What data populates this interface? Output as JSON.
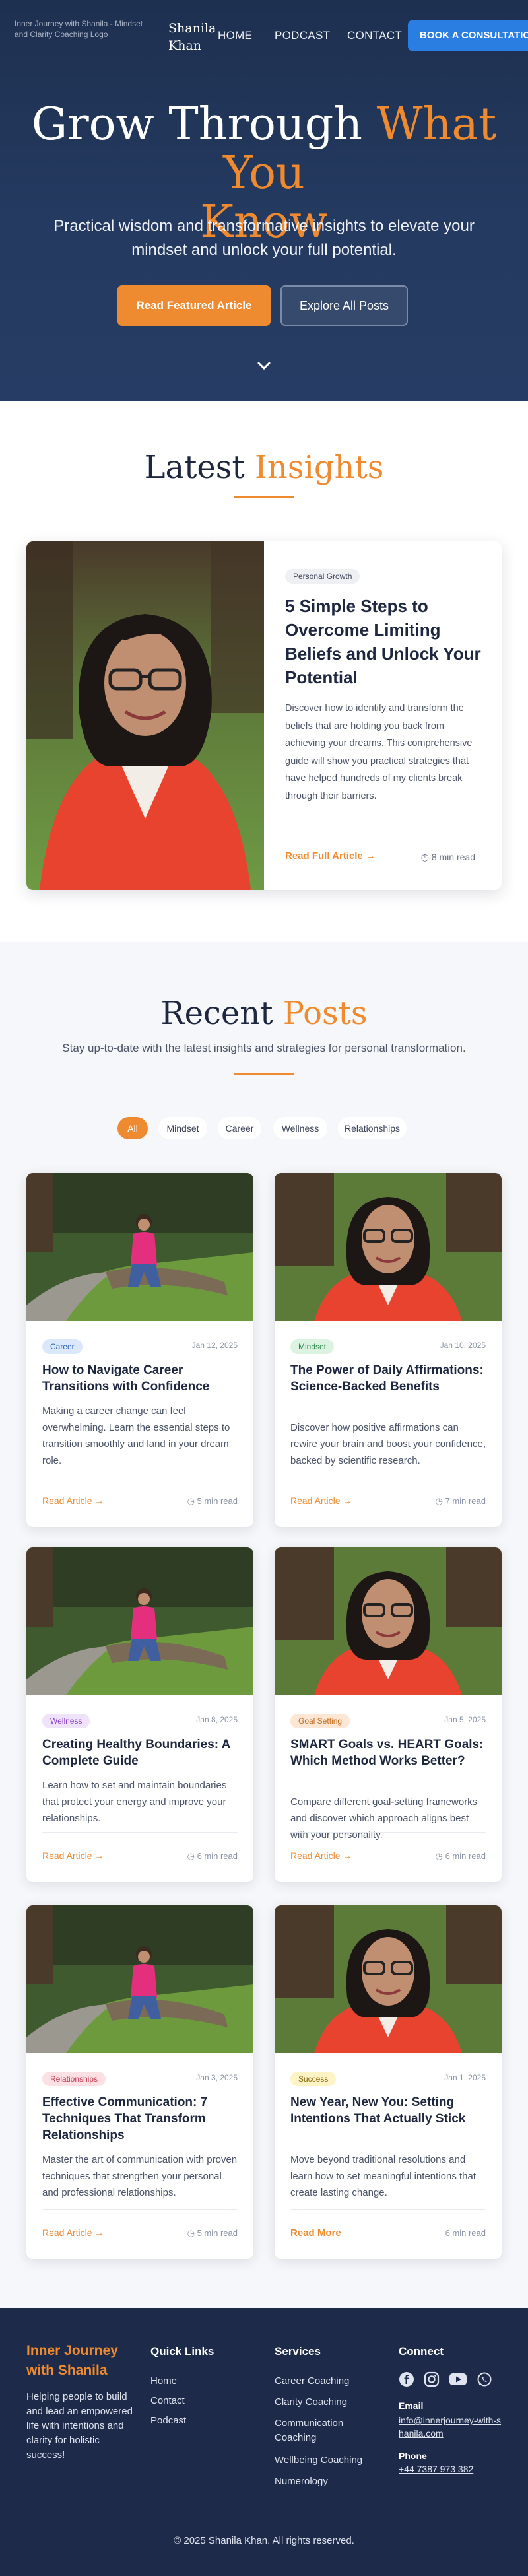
{
  "nav": {
    "logo_alt": "Inner Journey with Shanila - Mindset and Clarity Coaching Logo",
    "brand": [
      "Shanila",
      "Khan"
    ],
    "links": [
      "HOME",
      "PODCAST",
      "CONTACT"
    ],
    "cta": "BOOK A CONSULTATION"
  },
  "hero": {
    "title_plain": "Grow Through ",
    "title_accent_1": "What You",
    "title_accent_2": "Know",
    "subtitle": "Practical wisdom and transformative insights to elevate your mindset and unlock your full potential.",
    "primary_button": "Read Featured Article",
    "secondary_button": "Explore All Posts"
  },
  "latest": {
    "title_plain": "Latest ",
    "title_accent": "Insights",
    "featured": {
      "tag": "Personal Growth",
      "title": "5 Simple Steps to Overcome Limiting Beliefs and Unlock Your Potential",
      "excerpt": "Discover how to identify and transform the beliefs that are holding you back from achieving your dreams. This comprehensive guide will show you practical strategies that have helped hundreds of my clients break through their barriers.",
      "read_link": "Read Full Article",
      "read_time": "8 min read"
    }
  },
  "recent": {
    "title_plain": "Recent ",
    "title_accent": "Posts",
    "subtitle": "Stay up-to-date with the latest insights and strategies for personal transformation.",
    "filters": [
      "All",
      "Mindset",
      "Career",
      "Wellness",
      "Relationships"
    ],
    "active_filter": "All",
    "posts": [
      {
        "tag": "Career",
        "tag_bg": "#dbe8fb",
        "tag_fg": "#2a5fb5",
        "date": "Jan 12, 2025",
        "title": "How to Navigate Career Transitions with Confidence",
        "excerpt": "Making a career change can feel overwhelming. Learn the essential steps to transition smoothly and land in your dream role.",
        "read": "Read Article",
        "time": "5 min read",
        "photo": "park"
      },
      {
        "tag": "Mindset",
        "tag_bg": "#dcf3e2",
        "tag_fg": "#2a8a4a",
        "date": "Jan 10, 2025",
        "title": "The Power of Daily Affirmations: Science-Backed Benefits",
        "excerpt": "Discover how positive affirmations can rewire your brain and boost your confidence, backed by scientific research.",
        "read": "Read Article",
        "time": "7 min read",
        "photo": "portrait"
      },
      {
        "tag": "Wellness",
        "tag_bg": "#efe2fb",
        "tag_fg": "#8a45c9",
        "date": "Jan 8, 2025",
        "title": "Creating Healthy Boundaries: A Complete Guide",
        "excerpt": "Learn how to set and maintain boundaries that protect your energy and improve your relationships.",
        "read": "Read Article",
        "time": "6 min read",
        "photo": "park"
      },
      {
        "tag": "Goal Setting",
        "tag_bg": "#fde6d3",
        "tag_fg": "#c46a1d",
        "date": "Jan 5, 2025",
        "title": "SMART Goals vs. HEART Goals: Which Method Works Better?",
        "excerpt": "Compare different goal-setting frameworks and discover which approach aligns best with your personality.",
        "read": "Read Article",
        "time": "6 min read",
        "photo": "portrait"
      },
      {
        "tag": "Relationships",
        "tag_bg": "#fde0e4",
        "tag_fg": "#c23a52",
        "date": "Jan 3, 2025",
        "title": "Effective Communication: 7 Techniques That Transform Relationships",
        "excerpt": "Master the art of communication with proven techniques that strengthen your personal and professional relationships.",
        "read": "Read Article",
        "time": "5 min read",
        "photo": "park"
      },
      {
        "tag": "Success",
        "tag_bg": "#fdf3c4",
        "tag_fg": "#8a6d12",
        "date": "Jan 1, 2025",
        "title": "New Year, New You: Setting Intentions That Actually Stick",
        "excerpt": "Move beyond traditional resolutions and learn how to set meaningful intentions that create lasting change.",
        "read": "Read More",
        "time": "6 min read",
        "photo": "portrait"
      }
    ]
  },
  "footer": {
    "brand_1": "Inner Journey",
    "brand_2": "with Shanila",
    "tagline": "Helping people to build and lead an empowered life with intentions and clarity for holistic success!",
    "quick_links_title": "Quick Links",
    "quick_links": [
      "Home",
      "Contact",
      "Podcast"
    ],
    "services_title": "Services",
    "services": [
      "Career Coaching",
      "Clarity Coaching",
      "Communication Coaching",
      "Wellbeing Coaching",
      "Numerology"
    ],
    "connect_title": "Connect",
    "email_label": "Email",
    "email": "info@innerjourney-with-shanila.com",
    "phone_label": "Phone",
    "phone": "+44 7387 973 382",
    "copyright": "© 2025 Shanila Khan. All rights reserved."
  },
  "colors": {
    "accent": "#ef8a2e",
    "navy": "#1e3050",
    "cta_blue": "#2a7de1"
  },
  "icons": [
    "chevron-down-icon",
    "arrow-right-icon",
    "clock-icon",
    "facebook-icon",
    "instagram-icon",
    "youtube-icon",
    "whatsapp-icon"
  ]
}
